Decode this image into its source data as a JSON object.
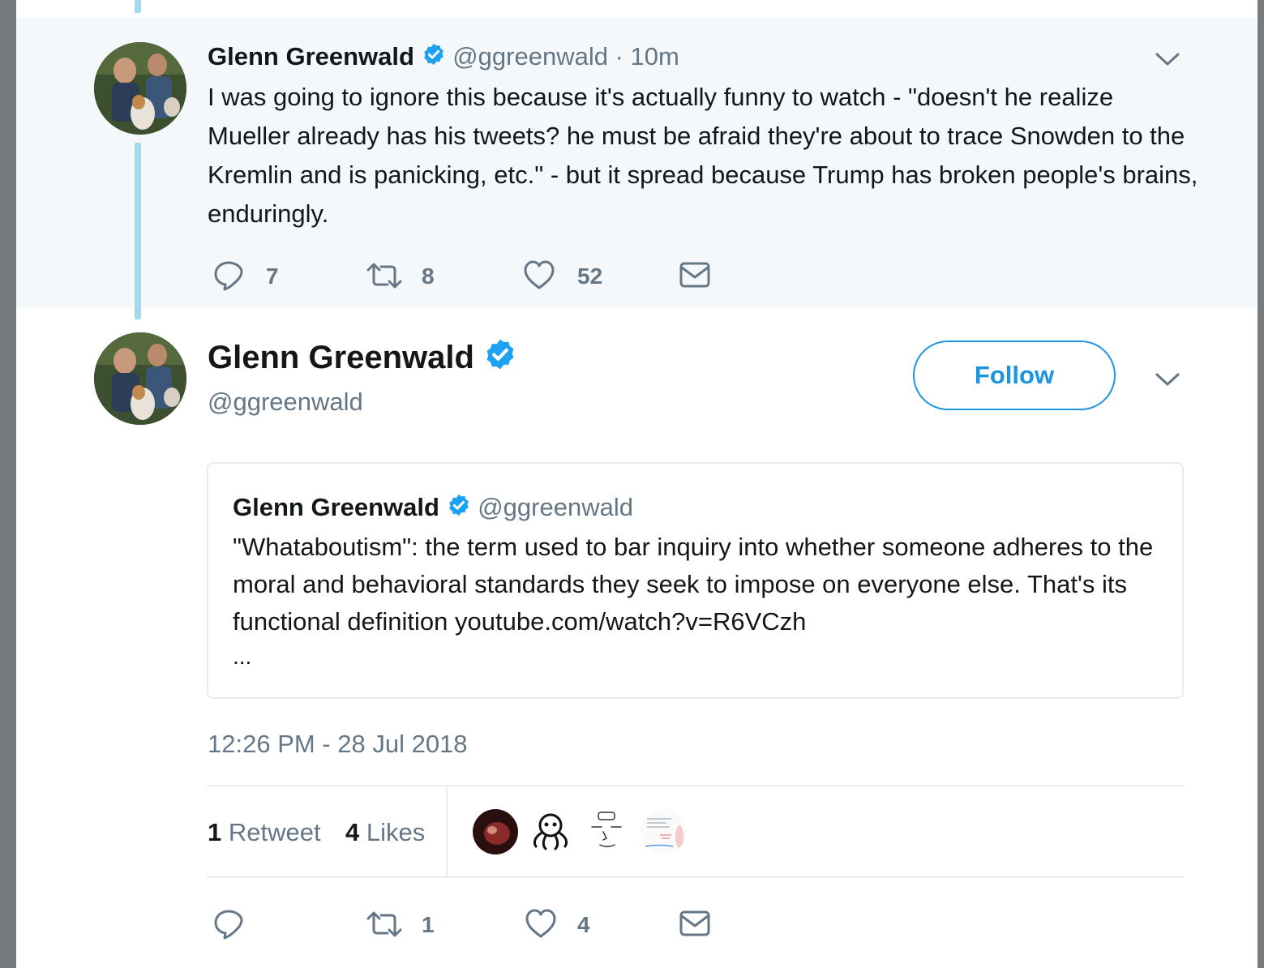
{
  "parent_tweet": {
    "name": "Glenn Greenwald",
    "handle": "@ggreenwald",
    "separator": "·",
    "time": "10m",
    "text": "I was going to ignore this because it's actually funny to watch - \"doesn't he realize Mueller already has his tweets? he must be afraid they're about to trace Snowden to the Kremlin and is panicking, etc.\" - but it spread because Trump has broken people's brains, enduringly.",
    "reply_count": "7",
    "retweet_count": "8",
    "like_count": "52"
  },
  "main_tweet": {
    "name": "Glenn Greenwald",
    "handle": "@ggreenwald",
    "follow_label": "Follow",
    "quote": {
      "name": "Glenn Greenwald",
      "handle": "@ggreenwald",
      "text": "\"Whataboutism\": the term used to bar inquiry into whether someone adheres to the moral and behavioral standards they seek to impose on everyone else. That's its functional definition youtube.com/watch?v=R6VCzh",
      "ellipsis": "..."
    },
    "timestamp": "12:26 PM - 28 Jul 2018",
    "stats": {
      "retweets_value": "1",
      "retweets_label": "Retweet",
      "likes_value": "4",
      "likes_label": "Likes"
    },
    "likers": [
      "liker-avatar-1",
      "liker-avatar-2",
      "liker-avatar-3",
      "liker-avatar-4"
    ],
    "reply_count": "",
    "retweet_count": "1",
    "like_count": "4"
  },
  "colors": {
    "accent": "#1b95e0",
    "verified": "#1da1f2",
    "thread_line": "#a4d9ec",
    "muted_text": "#657786",
    "parent_bg": "#f5f8fa"
  },
  "icons": [
    "verified-badge-icon",
    "reply-icon",
    "retweet-icon",
    "like-icon",
    "dm-icon",
    "chevron-down-icon"
  ]
}
